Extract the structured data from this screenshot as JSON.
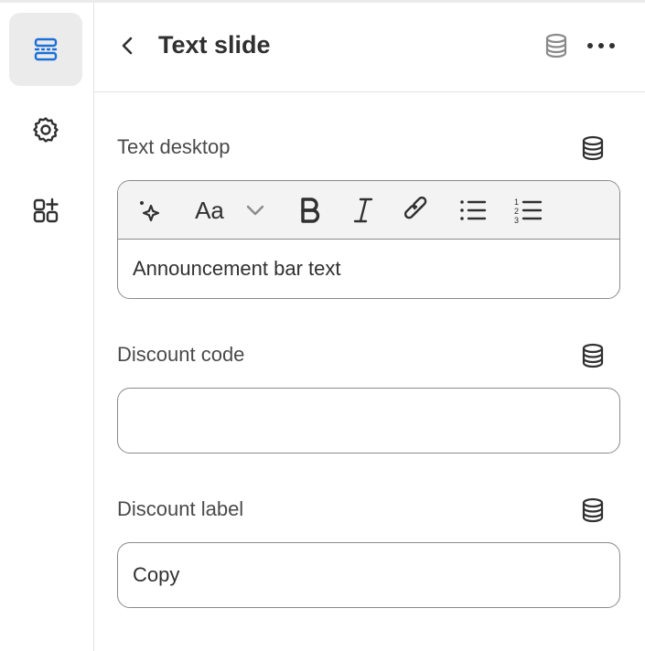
{
  "header": {
    "title": "Text slide",
    "back_icon": "chevron-left-icon",
    "source_icon": "database-icon",
    "more_icon": "more-horizontal-icon"
  },
  "sidebar": {
    "items": [
      {
        "name": "sections",
        "icon": "sections-icon",
        "active": true
      },
      {
        "name": "settings",
        "icon": "gear-icon",
        "active": false
      },
      {
        "name": "apps",
        "icon": "apps-add-icon",
        "active": false
      }
    ],
    "accent_color": "#1a6fd8"
  },
  "fields": {
    "text_desktop": {
      "label": "Text desktop",
      "value": "Announcement bar text",
      "toolbar": [
        "magic-icon",
        "font-style-icon",
        "chevron-down-icon",
        "bold-icon",
        "italic-icon",
        "link-icon",
        "bulleted-list-icon",
        "numbered-list-icon"
      ],
      "font_button_label": "Aa"
    },
    "discount_code": {
      "label": "Discount code",
      "value": ""
    },
    "discount_label": {
      "label": "Discount label",
      "value": "Copy"
    }
  }
}
